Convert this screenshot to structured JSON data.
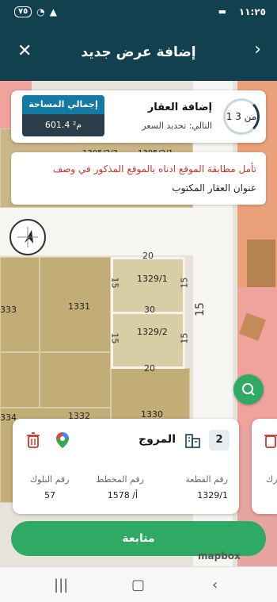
{
  "status_bar": {
    "time": "١١:٢٥",
    "battery": "٧٥"
  },
  "header": {
    "title": "إضافة عرض جديد"
  },
  "step_card": {
    "step_text": "1 من 3",
    "title": "إضافة العقار",
    "next_text": "التالي: تحديد السعر",
    "area_label": "إجمالي المساحة",
    "area_value": "601.4 م²"
  },
  "warning": {
    "line1": "تأمل مطابقة الموقع ادناه بالموقع المذكور في وصف",
    "line2": "عنوان العقار المكتوب"
  },
  "map": {
    "plots": [
      {
        "label": "1329/1"
      },
      {
        "label": "1329/2"
      }
    ],
    "parcel_labels": [
      "1331",
      "1330",
      "1332",
      "333",
      "334",
      "1305/2/3",
      "1305/2/1"
    ],
    "street_numbers": [
      "20",
      "15",
      "15",
      "15",
      "15",
      "20",
      "30",
      "15"
    ]
  },
  "property_card": {
    "index": "2",
    "district": "المروج",
    "columns": [
      {
        "label": "رقم القطعة",
        "value": "1329/1"
      },
      {
        "label": "رقم المخطط",
        "value": "1578 /أ"
      },
      {
        "label": "رقم البلوك",
        "value": "57"
      }
    ]
  },
  "peek_card": {
    "label": "رك"
  },
  "continue_button": {
    "label": "متابعة"
  },
  "attribution": {
    "text": "mapbox"
  },
  "icons": {
    "close": "close-icon",
    "back": "chevron-right-icon",
    "compass": "compass-icon",
    "search": "search-icon",
    "trash": "trash-icon",
    "map_pin": "google-maps-pin-icon",
    "building": "building-icon"
  },
  "colors": {
    "header": "#13404e",
    "accent_green": "#2eaa64",
    "area_label_bg": "#127aa3",
    "warning_text": "#d0342c"
  }
}
